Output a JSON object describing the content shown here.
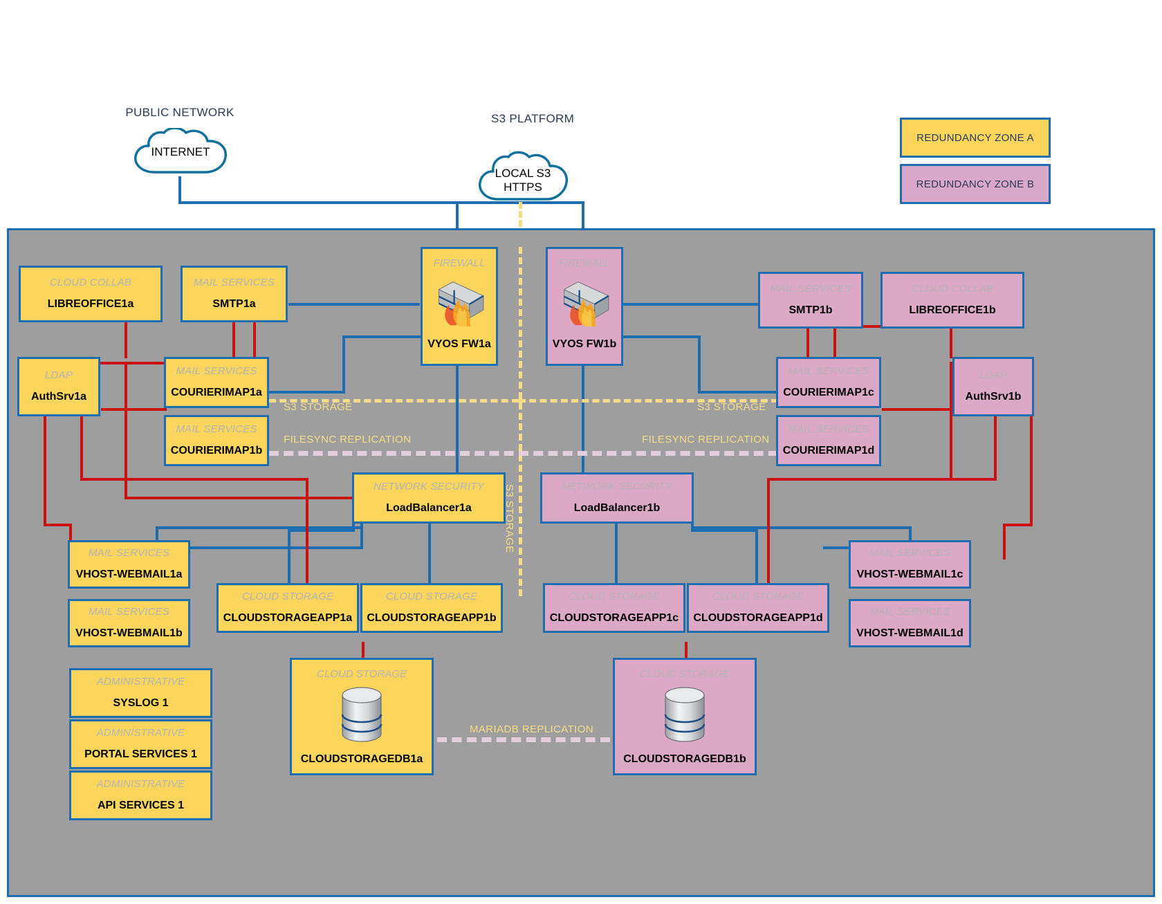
{
  "top_labels": {
    "public_network": "PUBLIC NETWORK",
    "s3_platform": "S3 PLATFORM"
  },
  "clouds": {
    "internet": {
      "label": "INTERNET"
    },
    "local_s3": {
      "line1": "LOCAL S3",
      "line2": "HTTPS"
    }
  },
  "legend": {
    "zone_a": "REDUNDANCY ZONE A",
    "zone_b": "REDUNDANCY ZONE B",
    "zone_a_color": "#fcd65c",
    "zone_b_color": "#d9a8c8",
    "border_color": "#1f6cb0"
  },
  "link_labels": {
    "s3_storage_left": "S3 STORAGE",
    "s3_storage_right": "S3 STORAGE",
    "filesync_left": "FILESYNC REPLICATION",
    "filesync_right": "FILESYNC REPLICATION",
    "s3_storage_vertical": "S3 STORAGE",
    "mariadb": "MARIADB REPLICATION"
  },
  "nodes": {
    "libreoffice1a": {
      "category": "CLOUD COLLAB",
      "name": "LIBREOFFICE1a"
    },
    "smtp1a": {
      "category": "MAIL SERVICES",
      "name": "SMTP1a"
    },
    "authsrv1a": {
      "category": "LDAP",
      "name": "AuthSrv1a"
    },
    "courierimap1a": {
      "category": "MAIL SERVICES",
      "name": "COURIERIMAP1a"
    },
    "courierimap1b": {
      "category": "MAIL SERVICES",
      "name": "COURIERIMAP1b"
    },
    "vyosfw1a": {
      "category": "FIREWALL",
      "name": "VYOS FW1a"
    },
    "vyosfw1b": {
      "category": "FIREWALL",
      "name": "VYOS FW1b"
    },
    "smtp1b": {
      "category": "MAIL SERVICES",
      "name": "SMTP1b"
    },
    "libreoffice1b": {
      "category": "CLOUD COLLAB",
      "name": "LIBREOFFICE1b"
    },
    "courierimap1c": {
      "category": "MAIL SERVICES",
      "name": "COURIERIMAP1c"
    },
    "courierimap1d": {
      "category": "MAIL SERVICES",
      "name": "COURIERIMAP1d"
    },
    "authsrv1b": {
      "category": "LDAP",
      "name": "AuthSrv1b"
    },
    "loadbalancer1a": {
      "category": "NETWORK SECURITY",
      "name": "LoadBalancer1a"
    },
    "loadbalancer1b": {
      "category": "NETWORK SECURITY",
      "name": "LoadBalancer1b"
    },
    "vhostwebmail1a": {
      "category": "MAIL SERVICES",
      "name": "VHOST-WEBMAIL1a"
    },
    "vhostwebmail1b": {
      "category": "MAIL SERVICES",
      "name": "VHOST-WEBMAIL1b"
    },
    "vhostwebmail1c": {
      "category": "MAIL SERVICES",
      "name": "VHOST-WEBMAIL1c"
    },
    "vhostwebmail1d": {
      "category": "MAIL SERVICES",
      "name": "VHOST-WEBMAIL1d"
    },
    "cloudstorageapp1a": {
      "category": "CLOUD STORAGE",
      "name": "CLOUDSTORAGEAPP1a"
    },
    "cloudstorageapp1b": {
      "category": "CLOUD STORAGE",
      "name": "CLOUDSTORAGEAPP1b"
    },
    "cloudstorageapp1c": {
      "category": "CLOUD STORAGE",
      "name": "CLOUDSTORAGEAPP1c"
    },
    "cloudstorageapp1d": {
      "category": "CLOUD STORAGE",
      "name": "CLOUDSTORAGEAPP1d"
    },
    "syslog1": {
      "category": "ADMINISTRATIVE",
      "name": "SYSLOG 1"
    },
    "portalservices1": {
      "category": "ADMINISTRATIVE",
      "name": "PORTAL SERVICES 1"
    },
    "apiservices1": {
      "category": "ADMINISTRATIVE",
      "name": "API SERVICES 1"
    },
    "cloudstoragedb1a": {
      "category": "CLOUD STORAGE",
      "name": "CLOUDSTORAGEDB1a"
    },
    "cloudstoragedb1b": {
      "category": "CLOUD STORAGE",
      "name": "CLOUDSTORAGEDB1b"
    }
  }
}
